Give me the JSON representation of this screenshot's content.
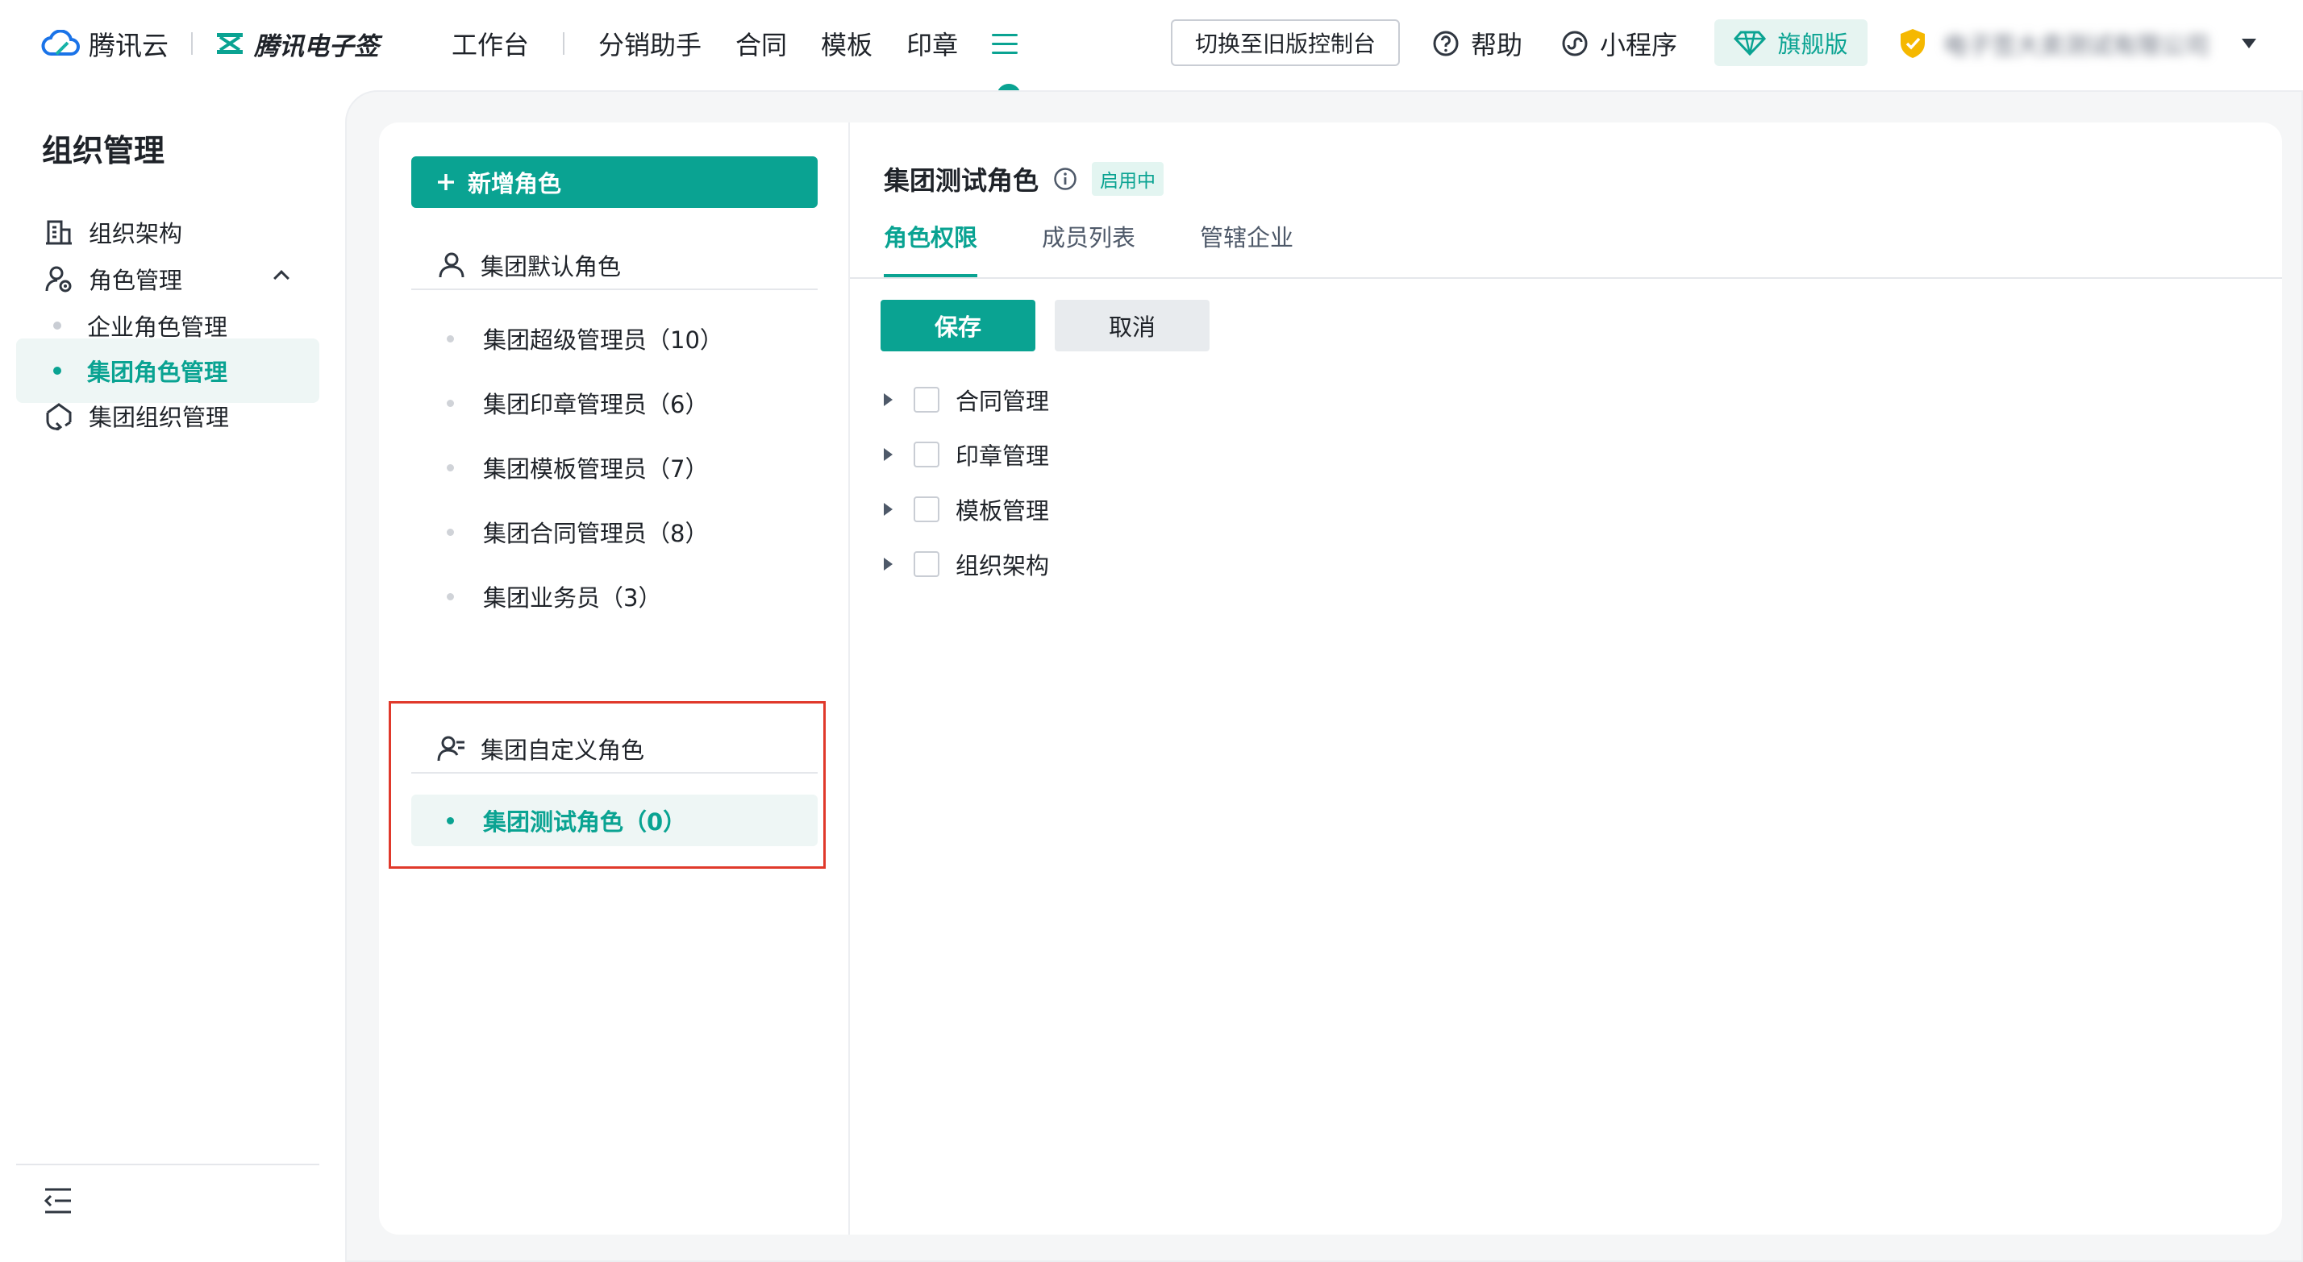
{
  "brand": {
    "cloud_name": "腾讯云",
    "product_name": "腾讯电子签",
    "accent": "#0aa392"
  },
  "nav": {
    "items": [
      "工作台",
      "分销助手",
      "合同",
      "模板",
      "印章"
    ],
    "menu_icon": "menu-icon"
  },
  "topbar": {
    "switch_label": "切换至旧版控制台",
    "help_label": "帮助",
    "miniapp_label": "小程序",
    "edition_label": "旗舰版",
    "account_name": "电子签大卖测试有限公司"
  },
  "sidebar": {
    "title": "组织管理",
    "items": [
      {
        "label": "组织架构",
        "icon": "org-structure-icon"
      },
      {
        "label": "角色管理",
        "icon": "role-manage-icon"
      },
      {
        "label": "企业角色管理"
      },
      {
        "label": "集团角色管理"
      },
      {
        "label": "集团组织管理",
        "icon": "group-org-icon"
      }
    ]
  },
  "roles": {
    "add_label": "新增角色",
    "default_group": "集团默认角色",
    "default_items": [
      "集团超级管理员（10）",
      "集团印章管理员（6）",
      "集团模板管理员（7）",
      "集团合同管理员（8）",
      "集团业务员（3）"
    ],
    "custom_group": "集团自定义角色",
    "custom_items": [
      "集团测试角色（0）"
    ]
  },
  "detail": {
    "title": "集团测试角色",
    "status": "启用中",
    "tabs": [
      "角色权限",
      "成员列表",
      "管辖企业"
    ],
    "save_label": "保存",
    "cancel_label": "取消",
    "permissions": [
      "合同管理",
      "印章管理",
      "模板管理",
      "组织架构"
    ]
  }
}
